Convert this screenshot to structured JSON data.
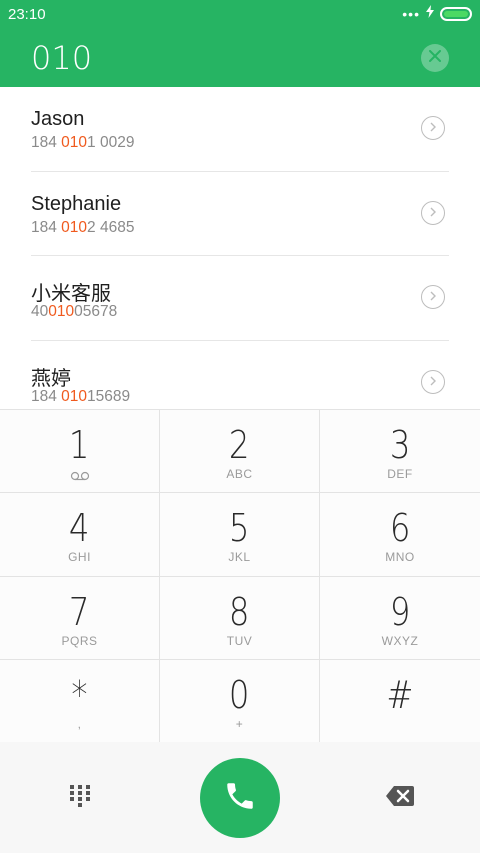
{
  "status_bar": {
    "time": "23:10",
    "icons": [
      "dots-icon",
      "charging-icon",
      "battery-icon"
    ]
  },
  "search": {
    "query": "010",
    "clear_icon": "close-icon"
  },
  "contacts": [
    {
      "name": "Jason",
      "number_prefix": "184 ",
      "number_match": "010",
      "number_suffix": "1 0029"
    },
    {
      "name": "Stephanie",
      "number_prefix": "184 ",
      "number_match": "010",
      "number_suffix": "2 4685"
    },
    {
      "name": "小米客服",
      "number_prefix": "40",
      "number_match": "010",
      "number_suffix": "05678"
    },
    {
      "name": "燕婷",
      "number_prefix": "184 ",
      "number_match": "010",
      "number_suffix": "15689"
    }
  ],
  "keypad": {
    "keys": [
      {
        "digit": "1",
        "letters": "",
        "icon": "voicemail-icon"
      },
      {
        "digit": "2",
        "letters": "ABC"
      },
      {
        "digit": "3",
        "letters": "DEF"
      },
      {
        "digit": "4",
        "letters": "GHI"
      },
      {
        "digit": "5",
        "letters": "JKL"
      },
      {
        "digit": "6",
        "letters": "MNO"
      },
      {
        "digit": "7",
        "letters": "PQRS"
      },
      {
        "digit": "8",
        "letters": "TUV"
      },
      {
        "digit": "9",
        "letters": "WXYZ"
      },
      {
        "digit": "*",
        "letters": ","
      },
      {
        "digit": "0",
        "letters": "+"
      },
      {
        "digit": "#",
        "letters": ""
      }
    ]
  },
  "bottom_bar": {
    "left_icon": "dialpad-icon",
    "center_icon": "phone-icon",
    "right_icon": "backspace-icon"
  },
  "colors": {
    "accent": "#26b463",
    "highlight": "#f05a1e"
  }
}
